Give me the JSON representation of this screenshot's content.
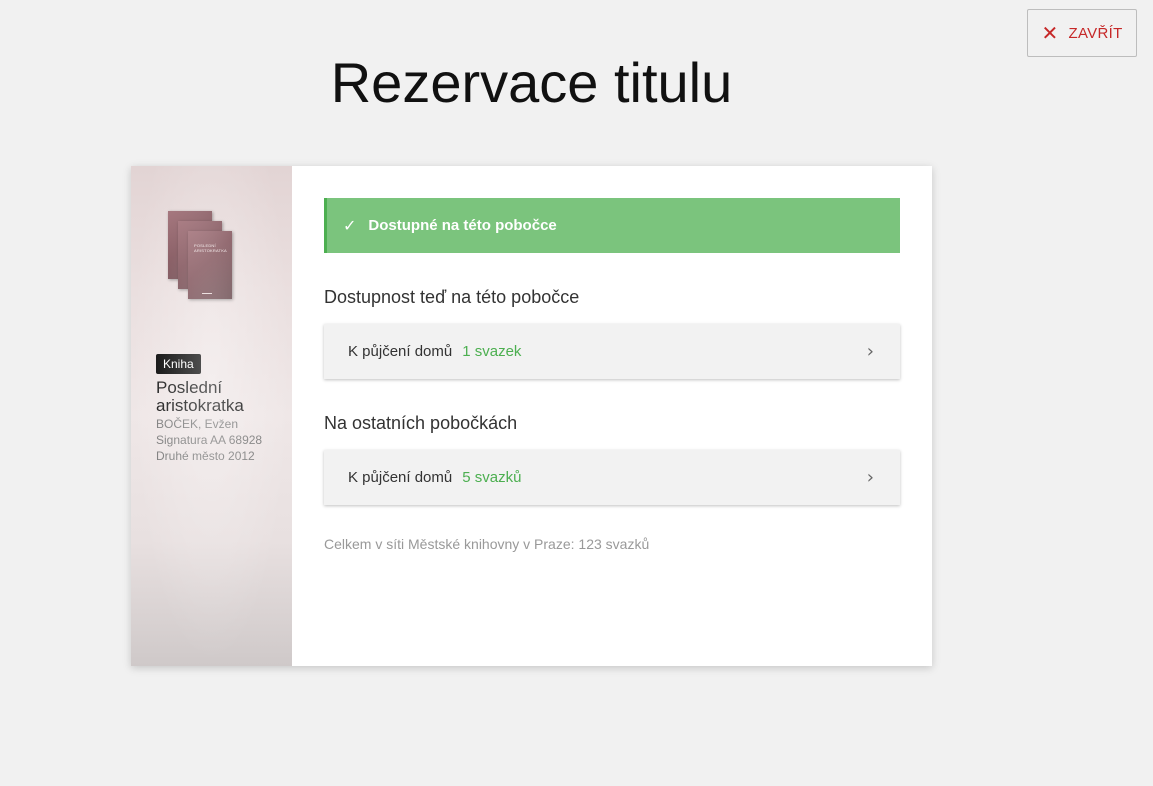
{
  "close_button": {
    "label": "ZAVŘÍT",
    "icon": "close-icon"
  },
  "page_title": "Rezervace titulu",
  "book": {
    "cover_text": "POSLEDNÍ ARISTOKRATKA",
    "type_badge": "Kniha",
    "title": "Poslední aristokratka",
    "author": "BOČEK, Evžen",
    "signature": "Signatura AA 68928",
    "publisher": "Druhé město 2012"
  },
  "status": {
    "text": "Dostupné na této pobočce",
    "icon": "check-icon",
    "color": "#7bc47d"
  },
  "sections": {
    "here": {
      "title": "Dostupnost teď na této pobočce",
      "row_label": "K půjčení domů",
      "row_count": "1 svazek"
    },
    "other": {
      "title": "Na ostatních pobočkách",
      "row_label": "K půjčení domů",
      "row_count": "5 svazků"
    }
  },
  "total": "Celkem v síti Městské knihovny v Praze: 123 svazků",
  "colors": {
    "accent_green": "#4caf50",
    "close_red": "#c62828"
  }
}
